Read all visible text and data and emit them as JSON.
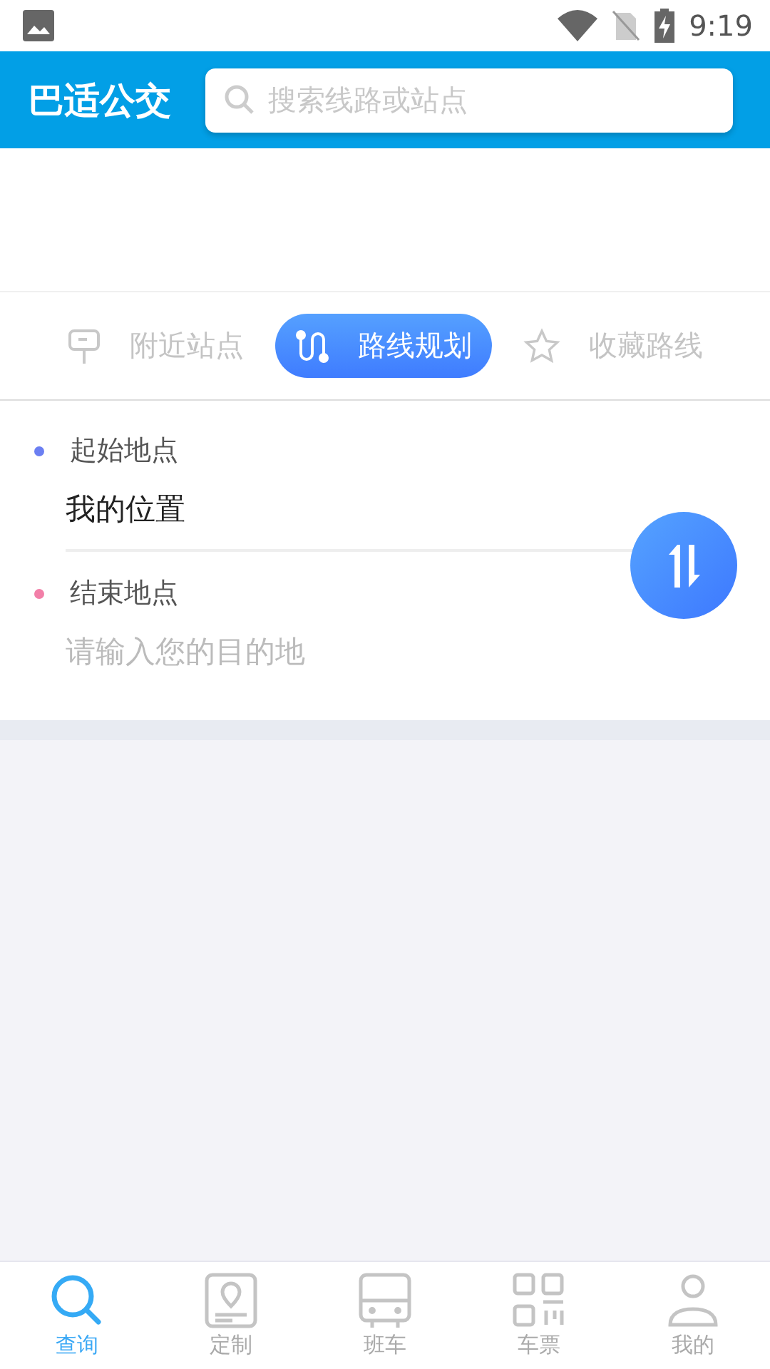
{
  "status_bar": {
    "time": "9:19"
  },
  "header": {
    "title": "巴适公交",
    "search": {
      "placeholder": "搜索线路或站点"
    }
  },
  "tabs": [
    {
      "kind": "stop",
      "label": "附近站点",
      "selected": false
    },
    {
      "kind": "route",
      "label": "路线规划",
      "selected": true
    },
    {
      "kind": "star",
      "label": "收藏路线",
      "selected": false
    }
  ],
  "route_form": {
    "fields": [
      {
        "label": "起始地点",
        "color": "#6b7ff2",
        "value": "我的位置"
      },
      {
        "label": "结束地点",
        "color": "#f27fa8",
        "placeholder": "请输入您的目的地"
      }
    ]
  },
  "bottom_nav": [
    {
      "kind": "search",
      "label": "查询",
      "selected": true
    },
    {
      "kind": "custom",
      "label": "定制",
      "selected": false
    },
    {
      "kind": "bus",
      "label": "班车",
      "selected": false
    },
    {
      "kind": "ticket",
      "label": "车票",
      "selected": false
    },
    {
      "kind": "user",
      "label": "我的",
      "selected": false
    }
  ]
}
